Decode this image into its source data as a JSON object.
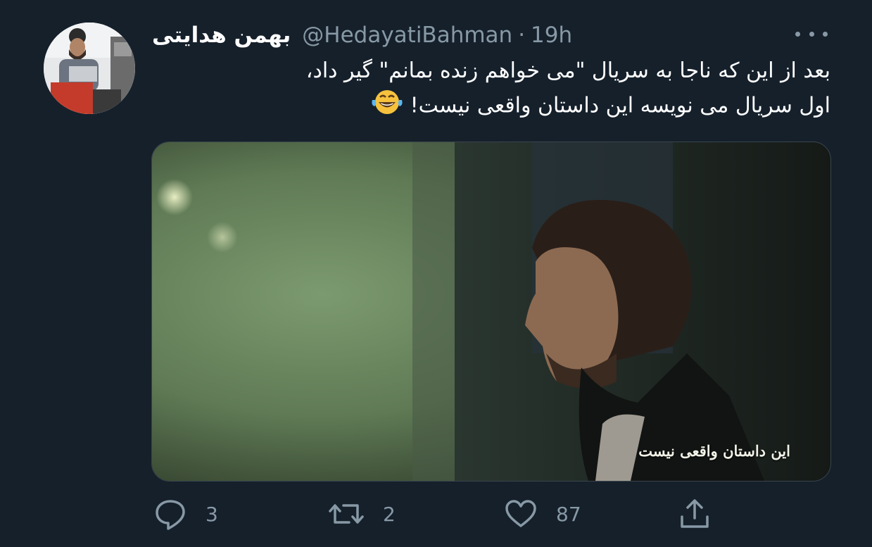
{
  "tweet": {
    "author": {
      "display_name": "بهمن هدایتی",
      "handle": "@HedayatiBahman",
      "separator": "·",
      "time": "19h"
    },
    "text_line_1": "بعد از این که ناجا به سریال \"می خواهم زنده بمانم\" گیر داد،",
    "text_line_2": "اول سریال می نویسه این داستان واقعی نیست!",
    "text_emoji": "😂",
    "media": {
      "subtitle": "این داستان واقعی نیست"
    },
    "actions": {
      "reply": {
        "icon": "reply-icon",
        "count": "3"
      },
      "retweet": {
        "icon": "retweet-icon",
        "count": "2"
      },
      "like": {
        "icon": "heart-icon",
        "count": "87"
      },
      "share": {
        "icon": "share-icon"
      }
    },
    "more_icon": "more-icon"
  },
  "colors": {
    "background": "#15202b",
    "primary_text": "#ffffff",
    "secondary_text": "#8899a6",
    "border": "#38444d"
  }
}
